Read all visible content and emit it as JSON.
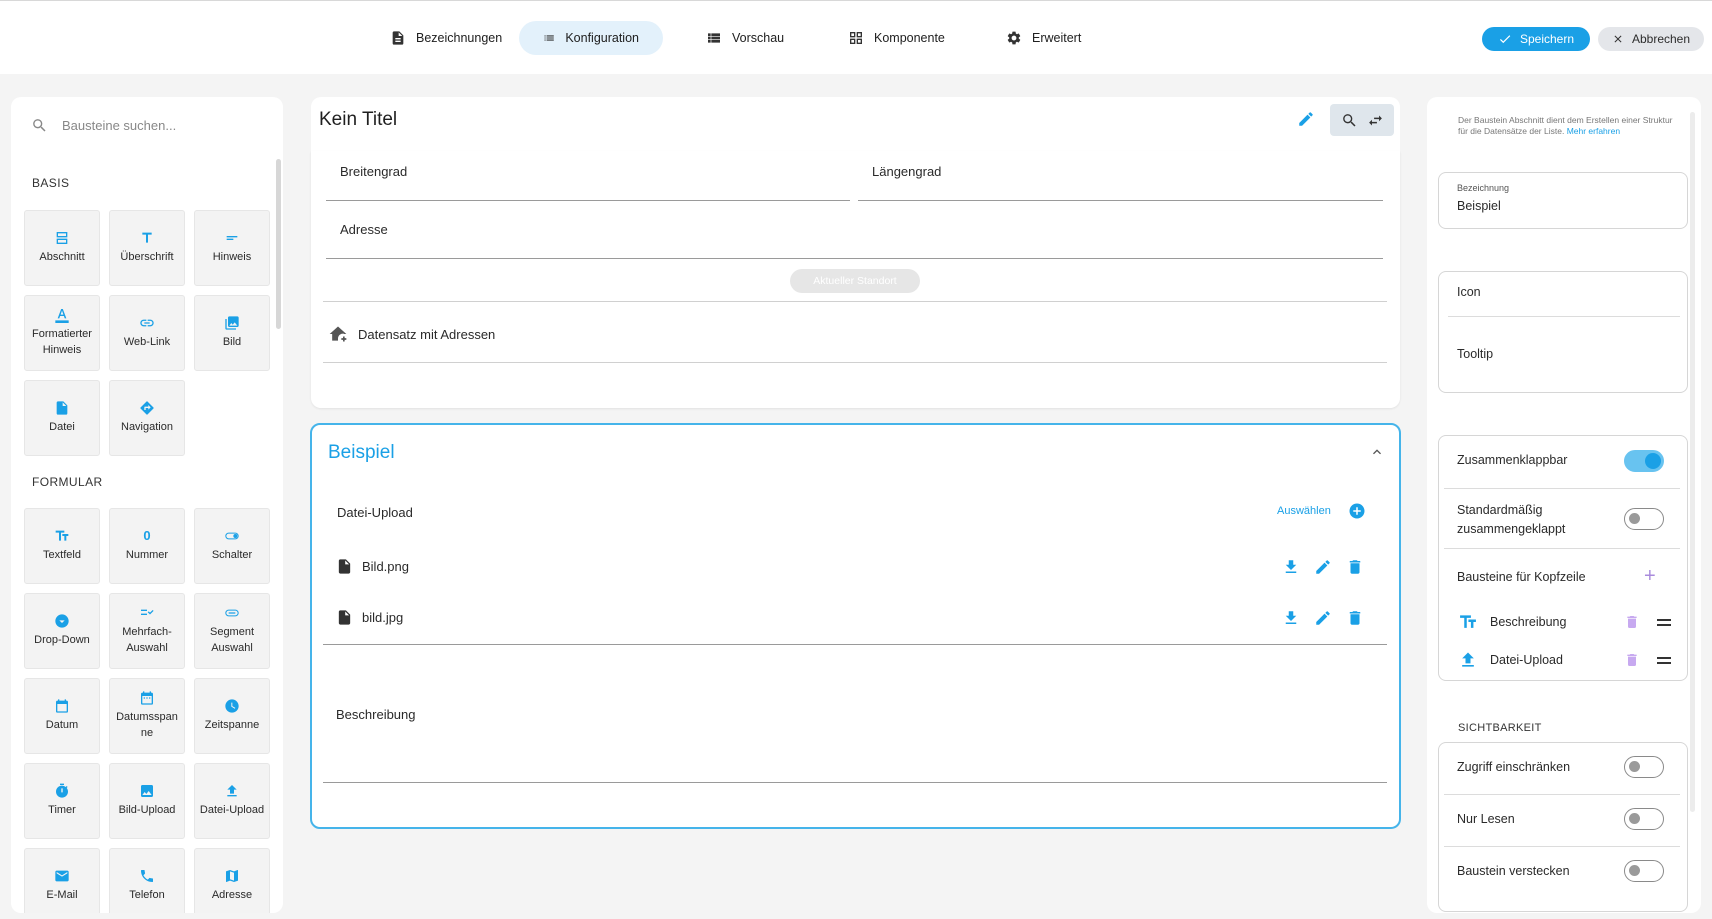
{
  "tabs": [
    {
      "label": "Bezeichnungen",
      "icon": "document-icon",
      "active": false
    },
    {
      "label": "Konfiguration",
      "icon": "list-icon",
      "active": true
    },
    {
      "label": "Vorschau",
      "icon": "table-view-icon",
      "active": false
    },
    {
      "label": "Komponente",
      "icon": "grid-icon",
      "active": false
    },
    {
      "label": "Erweitert",
      "icon": "gear-icon",
      "active": false
    }
  ],
  "actions": {
    "save": "Speichern",
    "cancel": "Abbrechen"
  },
  "palette": {
    "search_placeholder": "Bausteine suchen...",
    "basis_title": "BASIS",
    "basis": [
      "Abschnitt",
      "Überschrift",
      "Hinweis",
      "Formatierter Hinweis",
      "Web-Link",
      "Bild",
      "Datei",
      "Navigation"
    ],
    "formular_title": "FORMULAR",
    "formular": [
      "Textfeld",
      "Nummer",
      "Schalter",
      "Drop-Down",
      "Mehrfach-Auswahl",
      "Segment Auswahl",
      "Datum",
      "Datumsspanne",
      "Zeitspanne",
      "Timer",
      "Bild-Upload",
      "Datei-Upload",
      "E-Mail",
      "Telefon",
      "Adresse"
    ],
    "formular_display": [
      "Textfeld",
      "Nummer",
      "Schalter",
      "Drop-Down",
      "Mehrfach-\nAuswahl",
      "Segment\nAuswahl",
      "Datum",
      "Datumsspan\nne",
      "Zeitspanne",
      "Timer",
      "Bild-Upload",
      "Datei-Upload",
      "E-Mail",
      "Telefon",
      "Adresse"
    ]
  },
  "main": {
    "title": "Kein Titel",
    "fields": {
      "latitude": "Breitengrad",
      "longitude": "Längengrad",
      "address": "Adresse"
    },
    "current_location_button": "Aktueller Standort",
    "dataset_label": "Datensatz mit Adressen",
    "section": {
      "title": "Beispiel",
      "upload_label": "Datei-Upload",
      "select_label": "Auswählen",
      "files": [
        "Bild.png",
        "bild.jpg"
      ],
      "description_label": "Beschreibung"
    }
  },
  "inspector": {
    "help_text": "Der Baustein Abschnitt dient dem Erstellen einer Struktur für die Datensätze der Liste.",
    "help_link": "Mehr erfahren",
    "bezeichnung_label": "Bezeichnung",
    "bezeichnung_value": "Beispiel",
    "icon_label": "Icon",
    "tooltip_label": "Tooltip",
    "collapsible_label": "Zusammenklappbar",
    "collapsible_on": true,
    "default_collapsed_label": "Standardmäßig zusammengeklappt",
    "default_collapsed_on": false,
    "header_blocks_label": "Bausteine für Kopfzeile",
    "header_blocks": [
      "Beschreibung",
      "Datei-Upload"
    ],
    "visibility_title": "SICHTBARKEIT",
    "restrict_access_label": "Zugriff einschränken",
    "read_only_label": "Nur Lesen",
    "hide_block_label": "Baustein verstecken"
  },
  "colors": {
    "accent": "#1aa0e6",
    "accent_light": "#e3f1fb",
    "purple": "#c7a9f0"
  }
}
